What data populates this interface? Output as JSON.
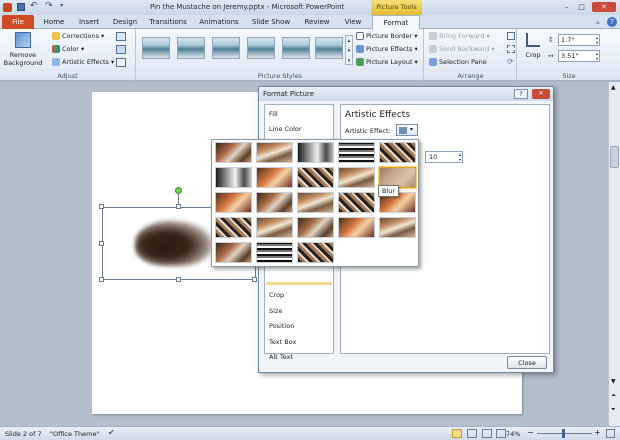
{
  "window": {
    "title": "Pin the Mustache on Jeremy.pptx - Microsoft PowerPoint",
    "context_tab": "Picture Tools",
    "minimize": "–",
    "maximize": "□",
    "close": "✕"
  },
  "tabs": [
    "File",
    "Home",
    "Insert",
    "Design",
    "Transitions",
    "Animations",
    "Slide Show",
    "Review",
    "View",
    "Format"
  ],
  "ribbon": {
    "adjust": {
      "label": "Adjust",
      "remove_background": "Remove Background",
      "corrections": "Corrections",
      "color": "Color",
      "artistic_effects": "Artistic Effects"
    },
    "picture_styles": {
      "label": "Picture Styles",
      "picture_border": "Picture Border",
      "picture_effects": "Picture Effects",
      "picture_layout": "Picture Layout"
    },
    "arrange": {
      "label": "Arrange",
      "bring_forward": "Bring Forward",
      "send_backward": "Send Backward",
      "selection_pane": "Selection Pane"
    },
    "size": {
      "label": "Size",
      "crop": "Crop",
      "height": "1.7\"",
      "width": "3.51\""
    }
  },
  "dialog": {
    "title": "Format Picture",
    "help": "?",
    "close": "✕",
    "left_items_top": [
      "Fill",
      "Line Color"
    ],
    "left_items_bottom": [
      "Crop",
      "Size",
      "Position",
      "Text Box",
      "Alt Text"
    ],
    "heading": "Artistic Effects",
    "effect_label": "Artistic Effect:",
    "value": "10",
    "close_button": "Close"
  },
  "gallery": {
    "tooltip": "Blur"
  },
  "status": {
    "slide": "Slide 2 of 7",
    "theme": "\"Office Theme\"",
    "zoom": "74%"
  }
}
